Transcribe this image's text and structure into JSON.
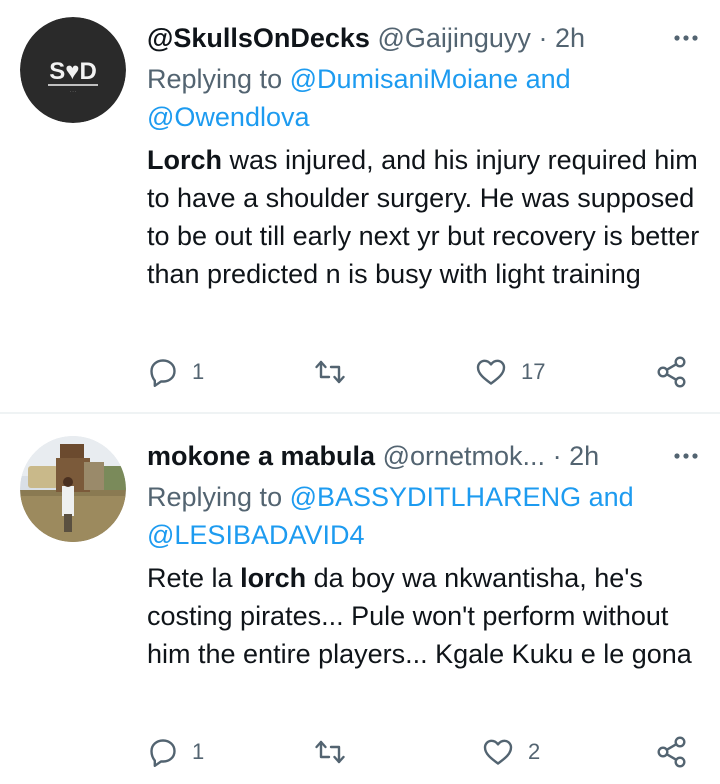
{
  "tweets": [
    {
      "display_name": "@SkullsOnDecks",
      "handle": "@Gaijinguyy",
      "separator": "·",
      "time": "2h",
      "avatar_text": "S♥D",
      "replying_prefix": "Replying to ",
      "replying_mention_1": "@DumisaniMoiane",
      "replying_and": " and",
      "replying_mention_2": "@Owendlova",
      "text_bold": "Lorch",
      "text_rest": " was injured, and his injury required him to have a shoulder surgery. He was supposed to be out till early next yr but recovery is better than predicted n is busy with light training",
      "reply_count": "1",
      "retweet_count": "",
      "like_count": "17"
    },
    {
      "display_name": "mokone a mabula",
      "handle": "@ornetmok...",
      "separator": "·",
      "time": "2h",
      "replying_prefix": "Replying to ",
      "replying_mention_1": "@BASSYDITLHARENG",
      "replying_and": " and",
      "replying_mention_2": "@LESIBADAVID4",
      "text_pre": "Rete la ",
      "text_bold": "lorch",
      "text_rest": " da boy wa nkwantisha, he's costing pirates... Pule won't perform without him the entire players... Kgale Kuku e le gona",
      "reply_count": "1",
      "retweet_count": "",
      "like_count": "2"
    }
  ],
  "icons": {
    "more": "more-horizontal-icon",
    "reply": "reply-bubble-icon",
    "retweet": "retweet-icon",
    "like": "heart-icon",
    "share": "share-icon"
  },
  "colors": {
    "text": "#0f1419",
    "secondary": "#536471",
    "mention": "#1d9bf0",
    "divider": "#eff3f4"
  }
}
